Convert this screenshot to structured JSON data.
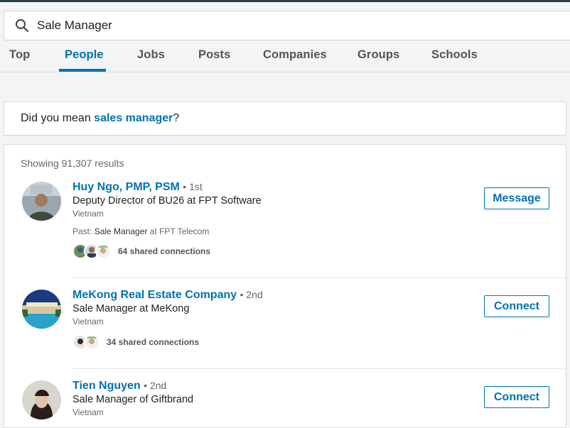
{
  "search": {
    "value": "Sale Manager"
  },
  "tabs": [
    {
      "label": "Top"
    },
    {
      "label": "People"
    },
    {
      "label": "Jobs"
    },
    {
      "label": "Posts"
    },
    {
      "label": "Companies"
    },
    {
      "label": "Groups"
    },
    {
      "label": "Schools"
    }
  ],
  "active_tab": "People",
  "suggestion": {
    "prefix": "Did you mean ",
    "link": "sales manager",
    "suffix": "?"
  },
  "results": {
    "count_text": "Showing 91,307 results",
    "items": [
      {
        "name": "Huy Ngo, PMP, PSM",
        "degree": "• 1st",
        "headline": "Deputy Director of BU26 at FPT Software",
        "location": "Vietnam",
        "past_label": "Past: ",
        "past_title": "Sale Manager",
        "past_rest": " at FPT Telecom",
        "shared": "64 shared connections",
        "action": "Message"
      },
      {
        "name": "MeKong Real Estate Company",
        "degree": "• 2nd",
        "headline": "Sale Manager at MeKong",
        "location": "Vietnam",
        "shared": "34 shared connections",
        "action": "Connect"
      },
      {
        "name": "Tien Nguyen",
        "degree": "• 2nd",
        "headline": "Sale Manager of Giftbrand",
        "location": "Vietnam",
        "action": "Connect"
      }
    ]
  },
  "colors": {
    "accent": "#0073b1",
    "background": "#f3f4f6"
  }
}
